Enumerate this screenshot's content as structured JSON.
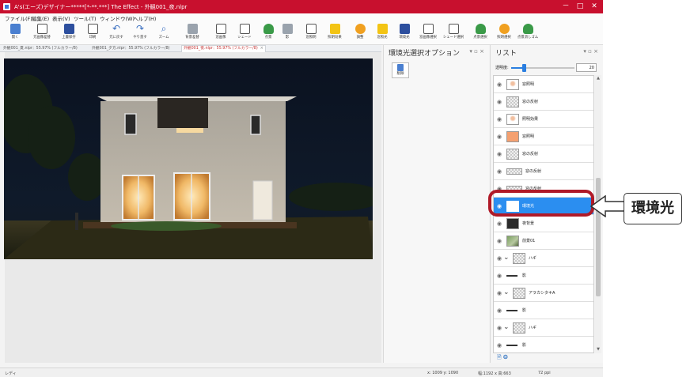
{
  "window": {
    "title": "A's(エーズ)デザイナー*****[*-**.***] The Effect - 外観001_夜.nlpr",
    "minimize": "－",
    "maximize": "□",
    "close": "✕"
  },
  "menu": [
    "ファイル(F)",
    "編集(E)",
    "表示(V)",
    "ツール(T)",
    "ウィンドウ(W)",
    "ヘルプ(H)"
  ],
  "toolbar": [
    {
      "label": "開く",
      "icon": "open-folder-icon",
      "color": "blue"
    },
    {
      "label": "元画像差替",
      "icon": "replace-image-icon",
      "color": "outline"
    },
    {
      "label": "上書保存",
      "icon": "save-icon",
      "color": "navy"
    },
    {
      "label": "印刷",
      "icon": "print-icon",
      "color": "outline"
    },
    {
      "label": "元に戻す",
      "icon": "undo-icon",
      "color": "glyph",
      "glyph": "↶"
    },
    {
      "label": "やり直す",
      "icon": "redo-icon",
      "color": "glyph",
      "glyph": "↷"
    },
    {
      "label": "ズーム",
      "icon": "zoom-icon",
      "color": "glyph",
      "glyph": "⌕"
    },
    {
      "label": "背景差替",
      "icon": "background-replace-icon",
      "color": "grey"
    },
    {
      "label": "窓画像",
      "icon": "window-image-icon",
      "color": "outline"
    },
    {
      "label": "シェード",
      "icon": "shade-icon",
      "color": "outline"
    },
    {
      "label": "点景",
      "icon": "tree-icon",
      "color": "green"
    },
    {
      "label": "影",
      "icon": "shadow-icon",
      "color": "grey"
    },
    {
      "label": "窓照明",
      "icon": "window-light-icon",
      "color": "outline"
    },
    {
      "label": "照明効果",
      "icon": "lighting-effect-icon",
      "color": "yellow"
    },
    {
      "label": "調整",
      "icon": "adjust-icon",
      "color": "orange"
    },
    {
      "label": "窓照光",
      "icon": "window-glow-icon",
      "color": "yellow"
    },
    {
      "label": "環境光",
      "icon": "ambient-light-icon",
      "color": "navy"
    },
    {
      "label": "窓画像選択",
      "icon": "window-select-icon",
      "color": "outline"
    },
    {
      "label": "シェード選択",
      "icon": "shade-select-icon",
      "color": "outline"
    },
    {
      "label": "点景選択",
      "icon": "tree-select-icon",
      "color": "green"
    },
    {
      "label": "照明選択",
      "icon": "light-select-icon",
      "color": "orange"
    },
    {
      "label": "点景消しゴム",
      "icon": "eraser-icon",
      "color": "green"
    }
  ],
  "tabs": [
    {
      "label": "外観001_夏.nlpr：55.97% (フルカラー/8)",
      "active": false
    },
    {
      "label": "外観001_夕方.nlpr：55.97% (フルカラー/8)",
      "active": false
    },
    {
      "label": "外観001_夜.nlpr：55.97% (フルカラー/8)",
      "active": true,
      "close": "×"
    }
  ],
  "options_panel": {
    "title": "環境光選択オプション",
    "controls": "▾ ▫ ×",
    "delete_label": "削除"
  },
  "list_panel": {
    "title": "リスト",
    "controls": "▾ ▫ ×",
    "opacity_label": "透明度:",
    "opacity_value": "20",
    "opacity_fraction": 0.2,
    "footer_icons": "🗎 ❂",
    "scroll_up": "▲",
    "scroll_down": "▼"
  },
  "layers": [
    {
      "name": "窓照明",
      "thumb": "light",
      "expander": false
    },
    {
      "name": "窓の反射",
      "thumb": "grid",
      "expander": false
    },
    {
      "name": "照明効果",
      "thumb": "light",
      "expander": false
    },
    {
      "name": "窓照明",
      "thumb": "warm",
      "expander": false
    },
    {
      "name": "窓の反射",
      "thumb": "grid",
      "expander": false
    },
    {
      "name": "窓の反射",
      "thumb": "wide",
      "expander": false
    },
    {
      "name": "窓の反射",
      "thumb": "wide",
      "expander": false
    },
    {
      "name": "環境光",
      "thumb": "blank",
      "expander": false,
      "selected": true
    },
    {
      "name": "夜背景",
      "thumb": "dark",
      "expander": false
    },
    {
      "name": "前景01",
      "thumb": "photo",
      "expander": false
    },
    {
      "name": "ハギ",
      "thumb": "grid",
      "expander": true
    },
    {
      "name": "影",
      "thumb": "line",
      "expander": false
    },
    {
      "name": "アラカシタキA",
      "thumb": "grid",
      "expander": true
    },
    {
      "name": "影",
      "thumb": "line",
      "expander": false
    },
    {
      "name": "ハギ",
      "thumb": "grid",
      "expander": true
    },
    {
      "name": "影",
      "thumb": "line",
      "expander": false
    }
  ],
  "status": {
    "left": "レディ",
    "coords": "x: 1009 y: 1090",
    "size": "幅:1192 x 高:663",
    "dpi": "72 ppi"
  },
  "callout": {
    "label": "環境光"
  },
  "colors": {
    "title_bar": "#c8102e",
    "selection": "#2b8ef0",
    "callout_ring": "#b01a28"
  }
}
